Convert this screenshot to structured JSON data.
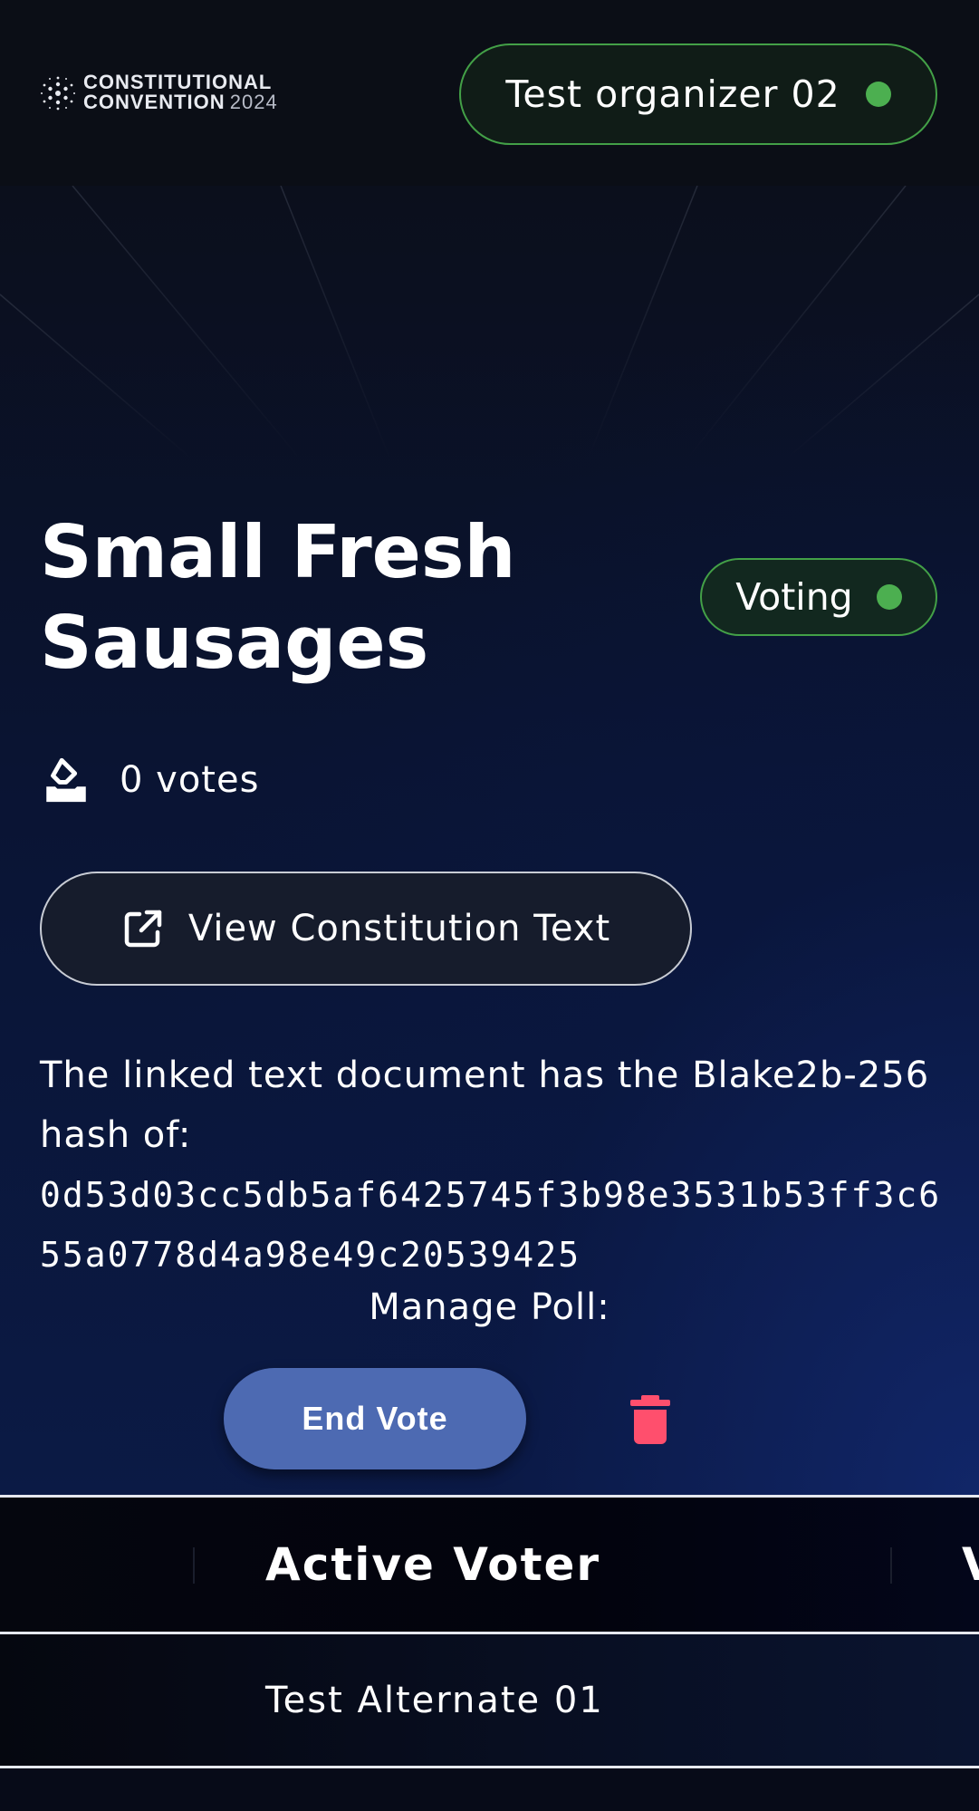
{
  "header": {
    "logo": {
      "line1": "CONSTITUTIONAL",
      "line2": "CONVENTION",
      "year": "2024"
    },
    "user": {
      "name": "Test organizer 02",
      "status_color": "#4caf50"
    }
  },
  "poll": {
    "title": "Small Fresh Sausages",
    "status": "Voting",
    "votes_label": "0 votes",
    "view_button": "View Constitution Text",
    "hash_intro": "The linked text document has the Blake2b-256 hash of:",
    "hash_value": "0d53d03cc5db5af6425745f3b98e3531b53ff3c655a0778d4a98e49c20539425",
    "manage_label": "Manage Poll:",
    "end_vote_button": "End Vote"
  },
  "table": {
    "headers": [
      "Active Voter",
      "V"
    ],
    "rows": [
      {
        "voter": "Test Alternate 01"
      }
    ]
  },
  "colors": {
    "accent_green": "#43a047",
    "end_vote_blue": "#4d6ab2",
    "trash_red": "#ff4f6d"
  },
  "icons": {
    "votes": "ballot-box-icon",
    "view": "external-link-icon",
    "delete": "trash-icon",
    "logo": "cardano-logo-icon"
  }
}
